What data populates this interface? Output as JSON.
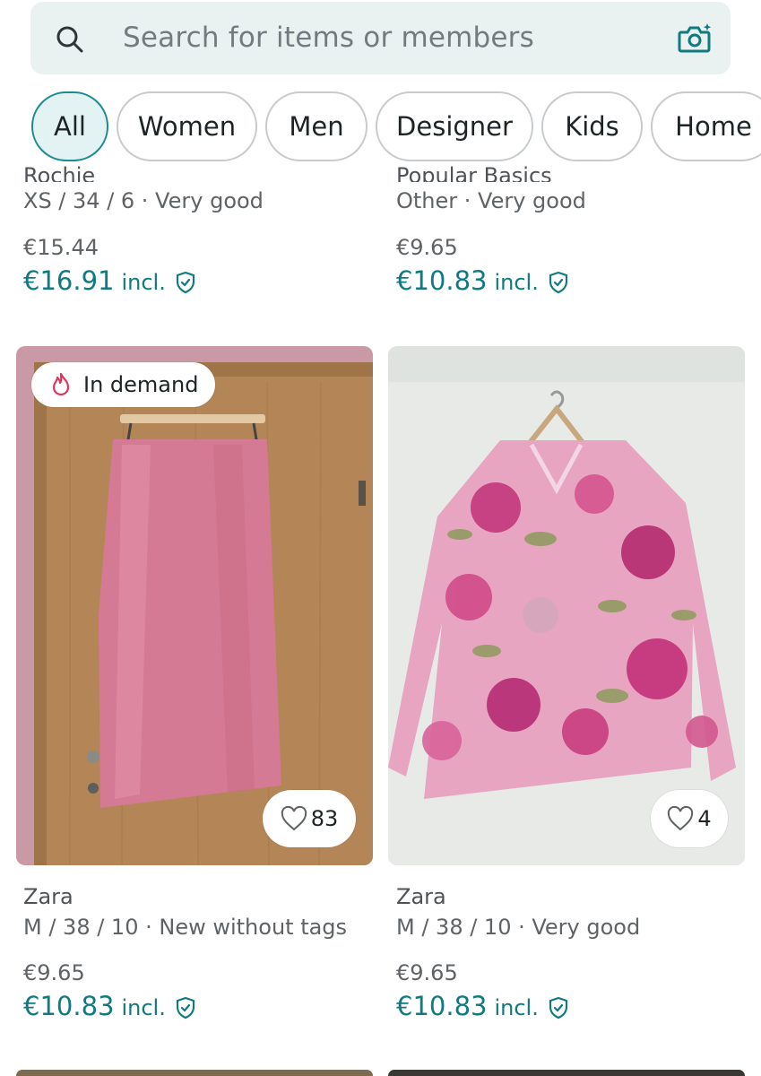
{
  "search": {
    "placeholder": "Search for items or members"
  },
  "filters": [
    "All",
    "Women",
    "Men",
    "Designer",
    "Kids",
    "Home"
  ],
  "top_items": [
    {
      "brand": "Rochie",
      "meta": "XS / 34 / 6 · Very good",
      "price": "€15.44",
      "price_incl": "€16.91",
      "incl_label": "incl."
    },
    {
      "brand": "Popular Basics",
      "meta": "Other · Very good",
      "price": "€9.65",
      "price_incl": "€10.83",
      "incl_label": "incl."
    }
  ],
  "items": [
    {
      "badge": "In demand",
      "favorites": "83",
      "brand": "Zara",
      "meta": "M / 38 / 10 · New without tags",
      "price": "€9.65",
      "price_incl": "€10.83",
      "incl_label": "incl."
    },
    {
      "favorites": "4",
      "brand": "Zara",
      "meta": "M / 38 / 10 · Very good",
      "price": "€9.65",
      "price_incl": "€10.83",
      "incl_label": "incl."
    }
  ],
  "icons": {
    "search": "search-icon",
    "camera": "camera-icon",
    "flame": "flame-icon",
    "heart": "heart-icon",
    "shield": "shield-check-icon"
  },
  "colors": {
    "accent": "#0f7a80",
    "active_pill_bg": "#e3f3f3",
    "search_bg": "#eaf1f1"
  }
}
